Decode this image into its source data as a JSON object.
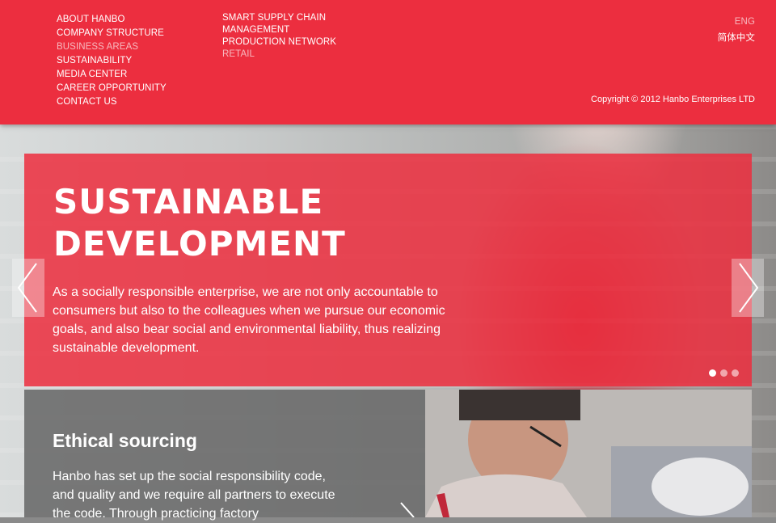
{
  "nav": {
    "primary": [
      {
        "label": "ABOUT HANBO",
        "active": false
      },
      {
        "label": "COMPANY STRUCTURE",
        "active": false
      },
      {
        "label": "BUSINESS AREAS",
        "active": true
      },
      {
        "label": "SUSTAINABILITY",
        "active": false
      },
      {
        "label": "MEDIA CENTER",
        "active": false
      },
      {
        "label": "CAREER OPPORTUNITY",
        "active": false
      },
      {
        "label": "CONTACT US",
        "active": false
      }
    ],
    "secondary": [
      {
        "label": "SMART SUPPLY CHAIN MANAGEMENT",
        "active": false
      },
      {
        "label": "PRODUCTION NETWORK",
        "active": false
      },
      {
        "label": "RETAIL",
        "active": true
      }
    ],
    "languages": [
      {
        "label": "ENG",
        "active": true
      },
      {
        "label": "简体中文",
        "active": false
      }
    ],
    "copyright": "Copyright © 2012 Hanbo Enterprises LTD"
  },
  "hero": {
    "title_line1": "SUSTAINABLE",
    "title_line2": "DEVELOPMENT",
    "text": "As a socially responsible enterprise, we are not only accountable to consumers but also to the colleagues when we pursue our economic goals, and also bear social and environmental liability, thus realizing sustainable development.",
    "slides_total": 3,
    "active_slide": 1
  },
  "card": {
    "title": "Ethical sourcing",
    "text": "Hanbo has set up the social responsibility code, and quality and we require all partners to execute the code. Through practicing factory"
  },
  "icons": {
    "prev": "chevron-left-icon",
    "next": "chevron-right-icon",
    "card_next": "chevron-right-icon"
  },
  "colors": {
    "brand_red": "#ec2e3f",
    "card_gray": "#696969"
  }
}
